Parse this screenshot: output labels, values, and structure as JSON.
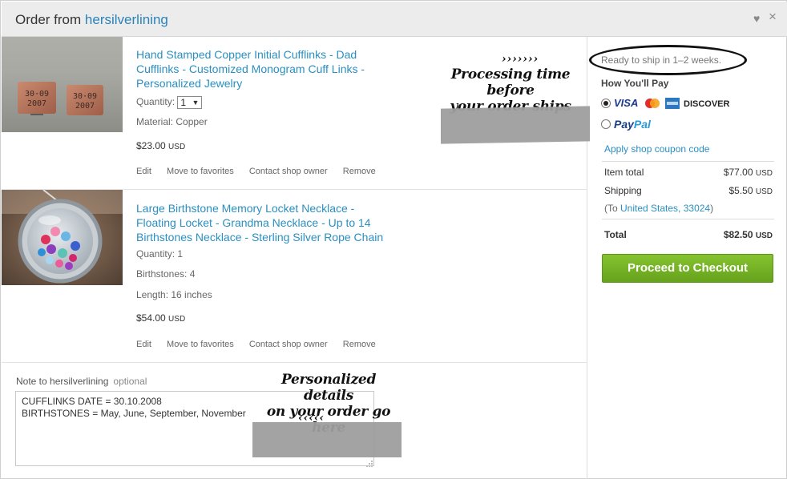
{
  "header": {
    "title_prefix": "Order from",
    "shop_name": "hersilverlining",
    "heart_icon": "♥",
    "close_icon": "×"
  },
  "items": [
    {
      "title": "Hand Stamped Copper Initial Cufflinks - Dad Cufflinks - Customized Monogram Cuff Links - Personalized Jewelry",
      "quantity_label": "Quantity:",
      "quantity_value": "1",
      "attr1": "Material: Copper",
      "price": "$23.00",
      "currency": "USD",
      "thumb_text_left": "30·09\n2007",
      "thumb_text_right": "30·09\n2007"
    },
    {
      "title": "Large Birthstone Memory Locket Necklace - Floating Locket - Grandma Necklace - Up to 14 Birthstones Necklace - Sterling Silver Rope Chain",
      "quantity_text": "Quantity: 1",
      "attr1": "Birthstones: 4",
      "attr2": "Length: 16 inches",
      "price": "$54.00",
      "currency": "USD"
    }
  ],
  "actions": {
    "edit": "Edit",
    "favorites": "Move to favorites",
    "contact": "Contact shop owner",
    "remove": "Remove"
  },
  "note": {
    "label": "Note to hersilverlining",
    "optional": "optional",
    "value": "CUFFLINKS DATE = 30.10.2008\nBIRTHSTONES = May, June, September, November"
  },
  "annotations": {
    "processing": "Processing time before\nyour order ships",
    "processing_arrows": "›››››››",
    "personalized": "Personalized details\non your order go here",
    "personalized_arrows": "‹‹‹‹‹"
  },
  "summary": {
    "ready_to_ship": "Ready to ship in 1–2 weeks.",
    "how_pay": "How You'll Pay",
    "visa": "VISA",
    "discover": "DISCOVER",
    "paypal_pay": "Pay",
    "paypal_pal": "Pal",
    "coupon": "Apply shop coupon code",
    "item_total_label": "Item total",
    "item_total": "$77.00",
    "shipping_label": "Shipping",
    "shipping": "$5.50",
    "currency": "USD",
    "ship_to_open": "(To ",
    "ship_to_link": "United States, 33024",
    "ship_to_close": ")",
    "total_label": "Total",
    "total": "$82.50",
    "checkout": "Proceed to Checkout"
  },
  "colors": {
    "link": "#2a8fc1",
    "checkout_green": "#76b326",
    "header_bg": "#ececec"
  }
}
